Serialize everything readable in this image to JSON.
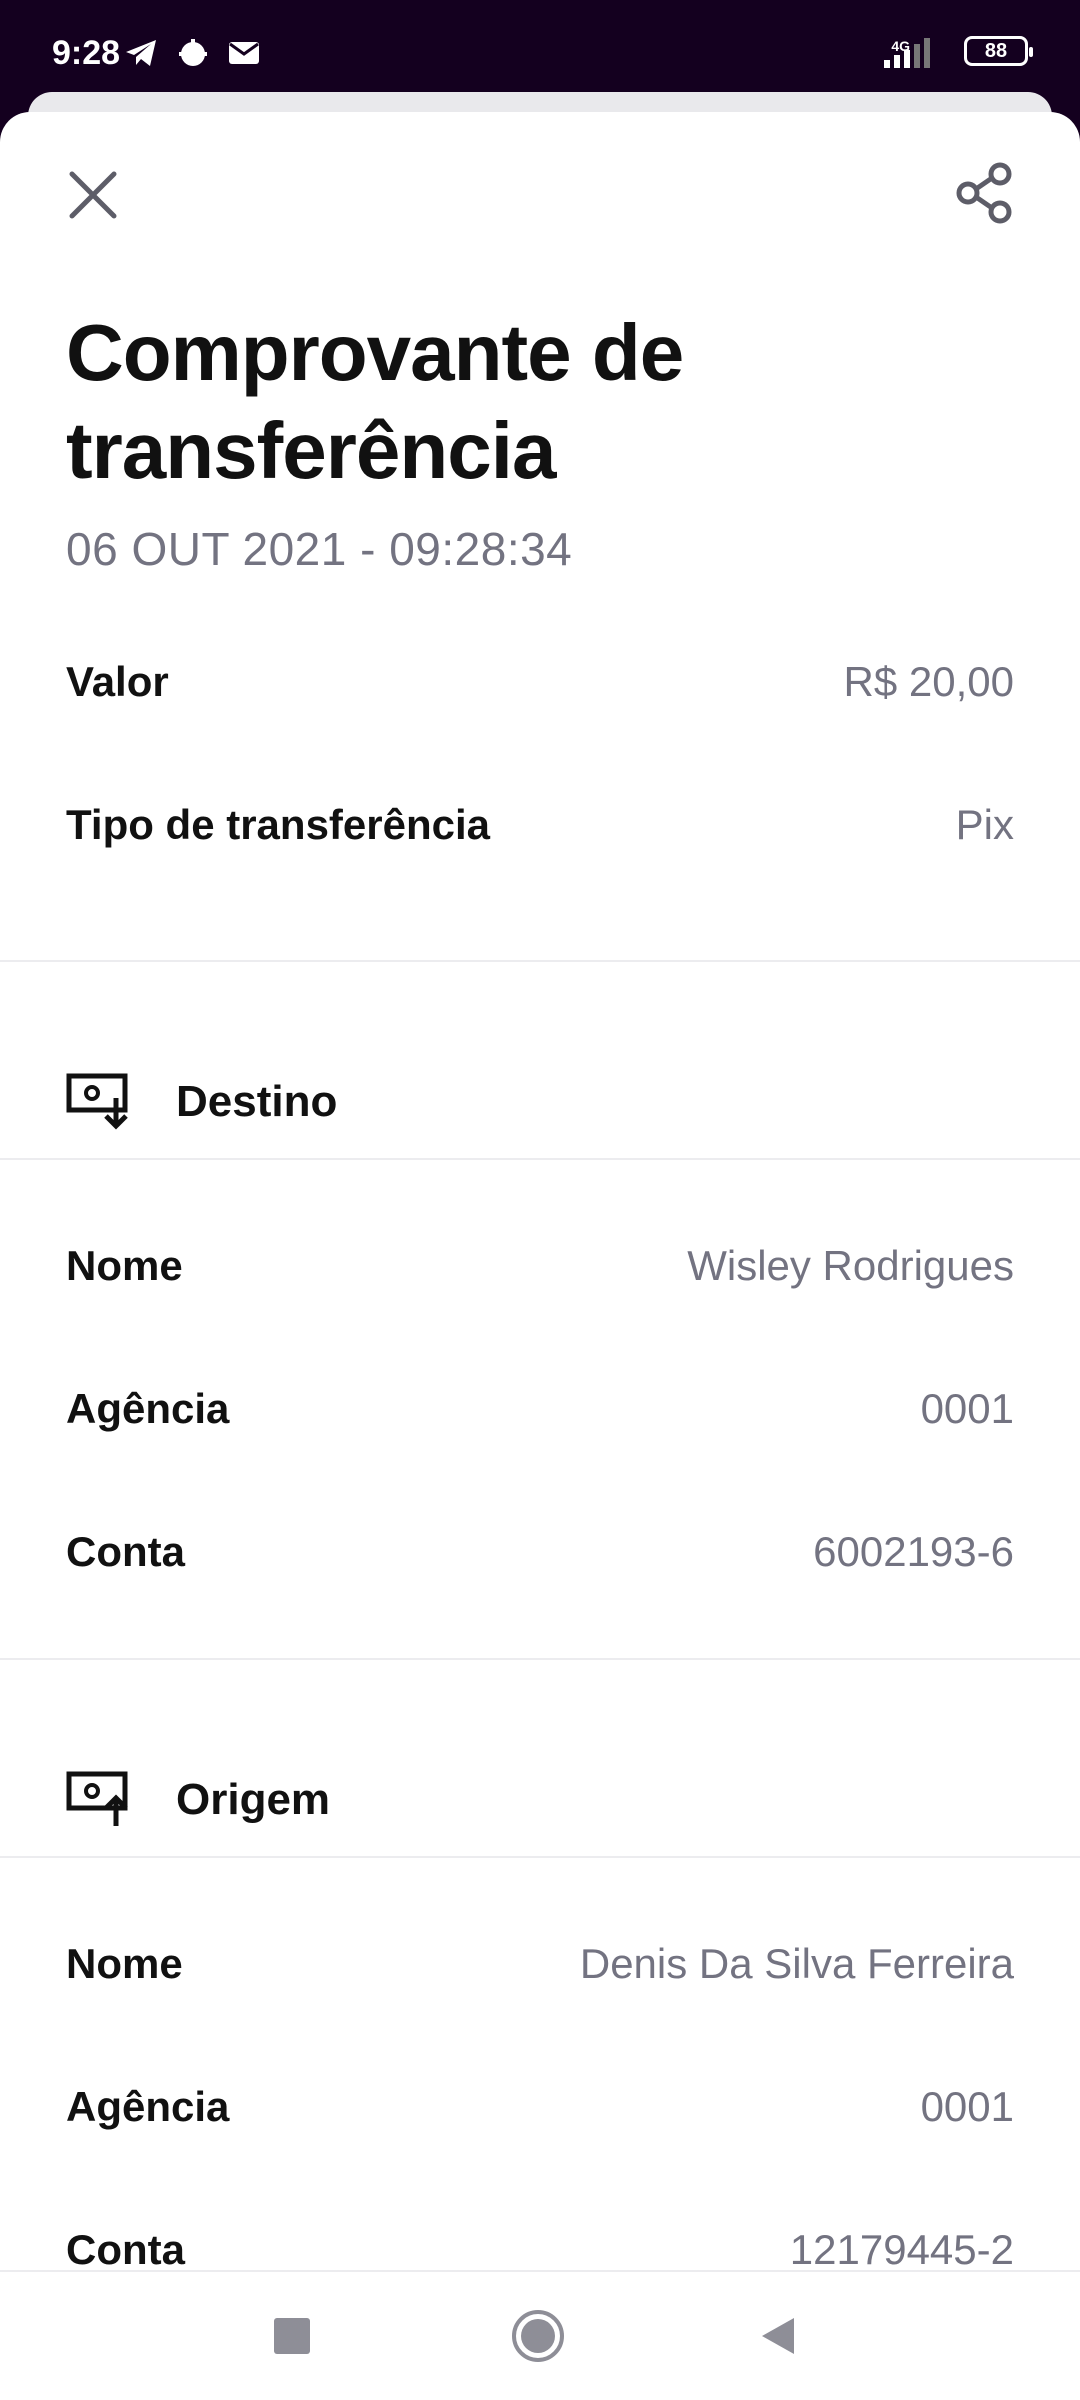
{
  "status_bar": {
    "time": "9:28",
    "network": "4G",
    "battery": "88",
    "icons": [
      "telegram-icon",
      "bug-icon",
      "mail-icon",
      "signal-icon",
      "battery-icon"
    ]
  },
  "header": {
    "close_icon": "close-icon",
    "share_icon": "share-icon"
  },
  "receipt": {
    "title": "Comprovante de transferência",
    "datetime": "06 OUT 2021 - 09:28:34",
    "summary": [
      {
        "label": "Valor",
        "value": "R$ 20,00"
      },
      {
        "label": "Tipo de transferência",
        "value": "Pix"
      }
    ],
    "destination": {
      "title": "Destino",
      "icon": "money-in-icon",
      "fields": [
        {
          "label": "Nome",
          "value": "Wisley Rodrigues"
        },
        {
          "label": "Agência",
          "value": "0001"
        },
        {
          "label": "Conta",
          "value": "6002193-6"
        }
      ]
    },
    "origin": {
      "title": "Origem",
      "icon": "money-out-icon",
      "fields": [
        {
          "label": "Nome",
          "value": "Denis Da Silva Ferreira"
        },
        {
          "label": "Agência",
          "value": "0001"
        },
        {
          "label": "Conta",
          "value": "12179445-2"
        }
      ]
    }
  },
  "nav_bar": {
    "buttons": [
      "recents-button",
      "home-button",
      "back-button"
    ]
  },
  "colors": {
    "status_bg": "#14001f",
    "text_primary": "#111111",
    "text_secondary": "#737381",
    "divider": "#ececef"
  }
}
